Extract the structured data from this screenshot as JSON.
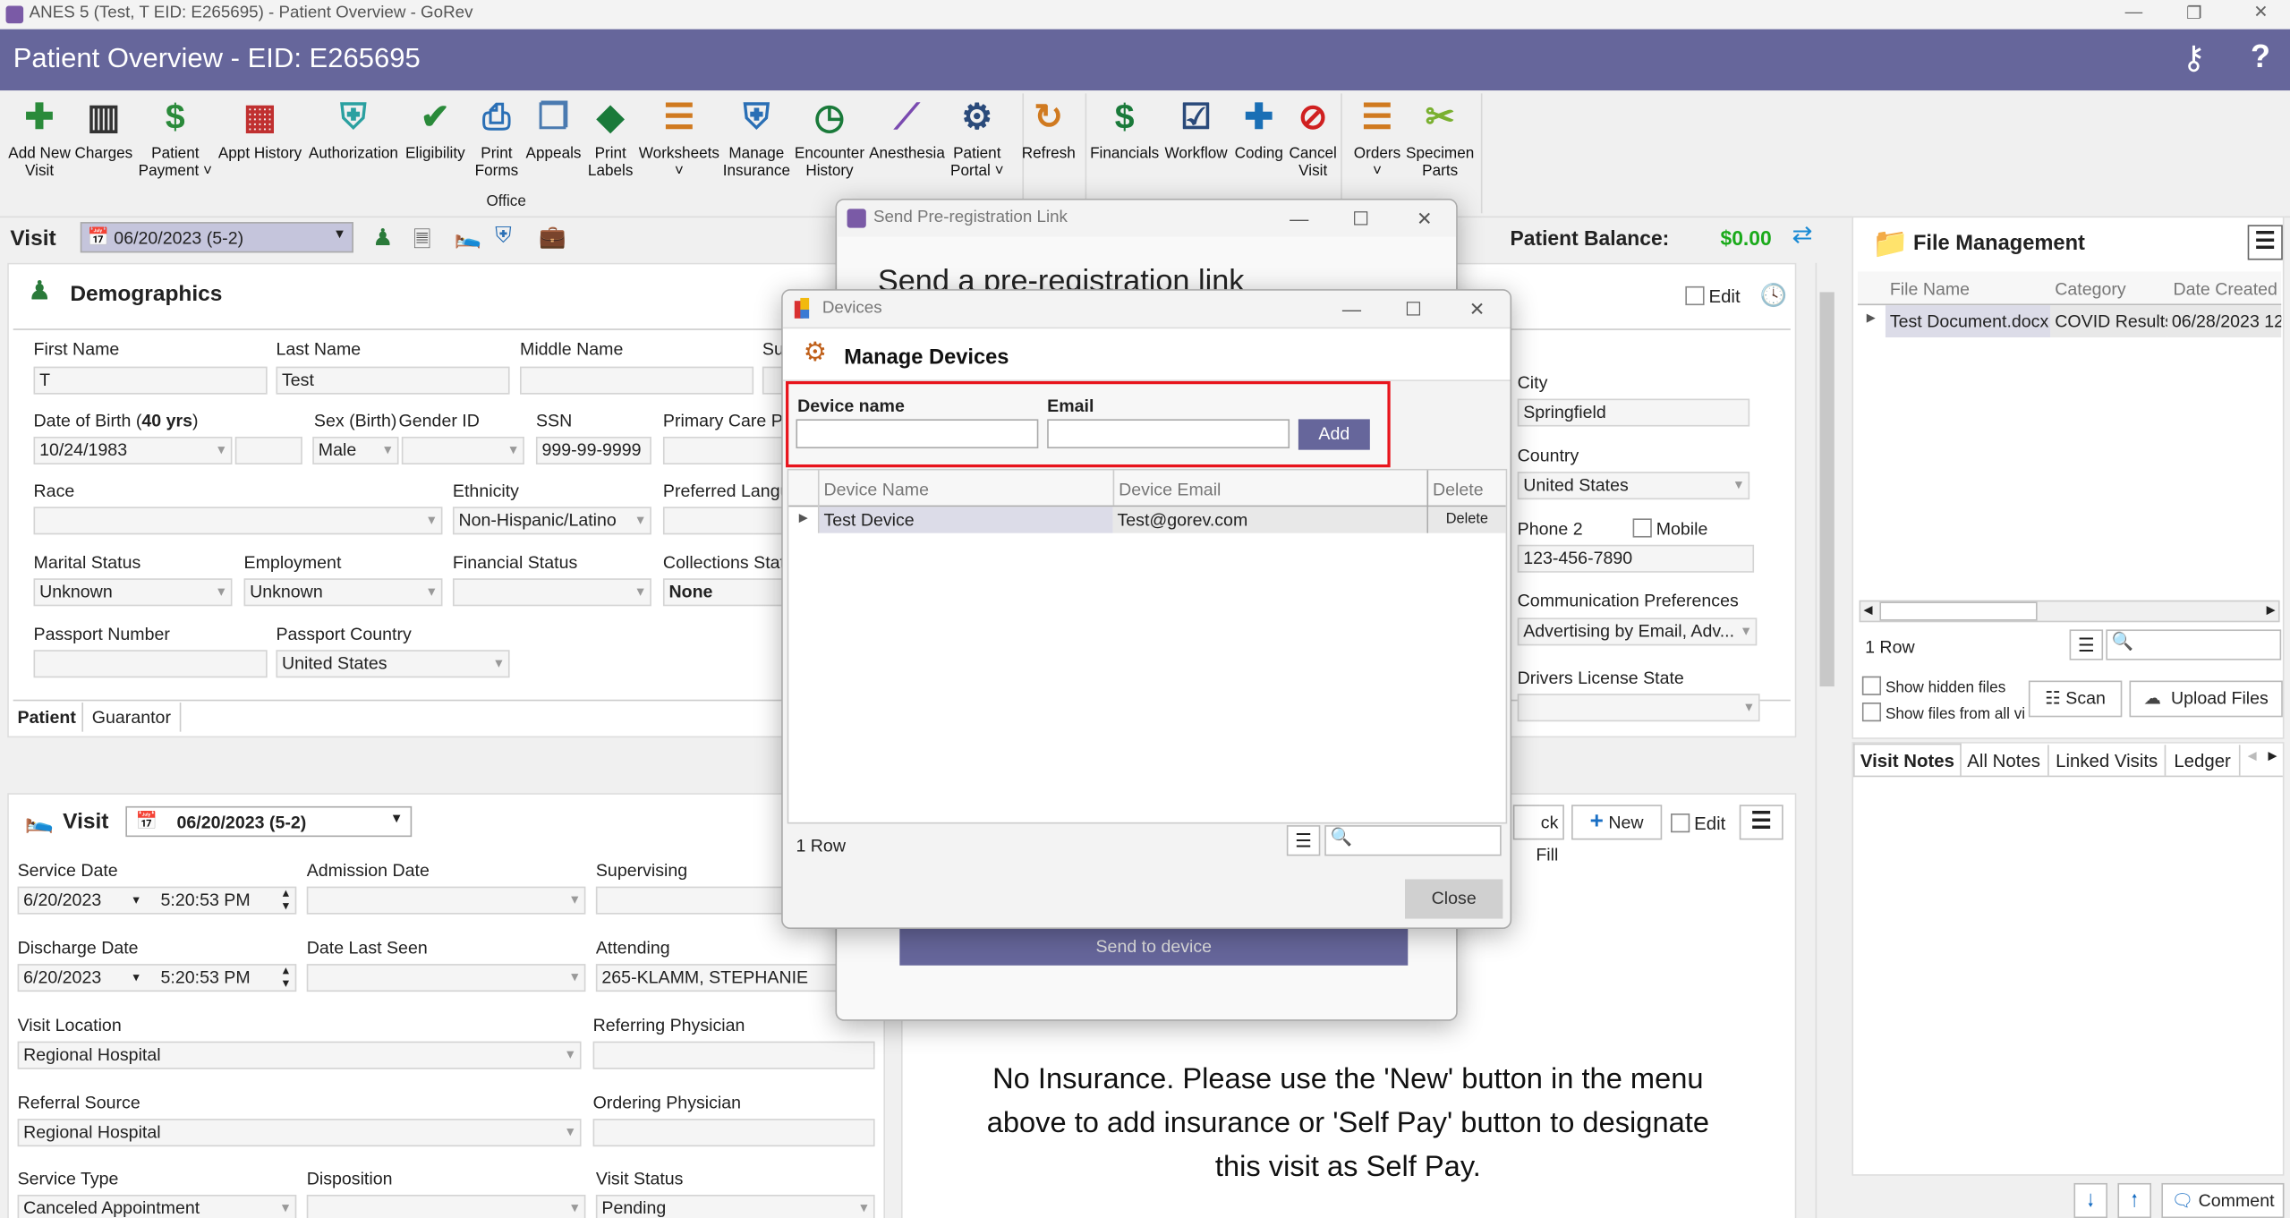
{
  "window": {
    "title": "ANES 5 (Test, T EID: E265695) - Patient Overview - GoRev"
  },
  "header": {
    "title": "Patient Overview - EID: E265695"
  },
  "ribbon": {
    "buttons": [
      {
        "label": "Add New\nVisit",
        "icon": "add-visit-icon"
      },
      {
        "label": "Charges",
        "icon": "barcode-icon"
      },
      {
        "label": "Patient\nPayment ˅",
        "icon": "payment-icon"
      },
      {
        "label": "Appt History",
        "icon": "calendar-icon"
      },
      {
        "label": "Authorization",
        "icon": "shield-clipboard-icon"
      },
      {
        "label": "Eligibility",
        "icon": "user-check-icon"
      },
      {
        "label": "Print\nForms",
        "icon": "printer-icon"
      },
      {
        "label": "Appeals",
        "icon": "documents-icon"
      },
      {
        "label": "Print\nLabels",
        "icon": "tag-icon"
      },
      {
        "label": "Worksheets\n˅",
        "icon": "worksheet-icon"
      },
      {
        "label": "Manage\nInsurance",
        "icon": "insurance-icon"
      },
      {
        "label": "Encounter\nHistory",
        "icon": "calendar-clock-icon"
      },
      {
        "label": "Anesthesia",
        "icon": "syringe-icon"
      },
      {
        "label": "Patient\nPortal ˅",
        "icon": "globe-gear-icon"
      },
      {
        "label": "Refresh",
        "icon": "refresh-icon"
      },
      {
        "label": "Financials",
        "icon": "dollar-icon"
      },
      {
        "label": "Workflow",
        "icon": "checklist-icon"
      },
      {
        "label": "Coding",
        "icon": "book-icon"
      },
      {
        "label": "Cancel\nVisit",
        "icon": "cancel-clock-icon"
      },
      {
        "label": "Orders\n˅",
        "icon": "orders-icon"
      },
      {
        "label": "Specimen\nParts",
        "icon": "specimen-icon"
      }
    ],
    "group_office": "Office"
  },
  "visitbar": {
    "label": "Visit",
    "selected": "06/20/2023 (5-2)",
    "balance_label": "Patient Balance:",
    "balance": "$0.00"
  },
  "demographics": {
    "title": "Demographics",
    "edit": "Edit",
    "dob_label": "Date of Birth (",
    "dob_age": "40 yrs",
    "dob_close": ")",
    "fields": {
      "first_name": {
        "label": "First Name",
        "value": "T"
      },
      "last_name": {
        "label": "Last Name",
        "value": "Test"
      },
      "middle_name": {
        "label": "Middle Name",
        "value": ""
      },
      "suffix": {
        "label": "Su",
        "value": ""
      },
      "dob": {
        "label": "",
        "value": "10/24/1983"
      },
      "sex": {
        "label": "Sex (Birth)",
        "value": "Male"
      },
      "gender": {
        "label": "Gender ID",
        "value": ""
      },
      "ssn": {
        "label": "SSN",
        "value": "999-99-9999"
      },
      "pcp": {
        "label": "Primary Care Ph",
        "value": ""
      },
      "race": {
        "label": "Race",
        "value": ""
      },
      "ethnicity": {
        "label": "Ethnicity",
        "value": "Non-Hispanic/Latino"
      },
      "language": {
        "label": "Preferred Langu",
        "value": ""
      },
      "marital": {
        "label": "Marital Status",
        "value": "Unknown"
      },
      "employment": {
        "label": "Employment",
        "value": "Unknown"
      },
      "financial": {
        "label": "Financial Status",
        "value": ""
      },
      "collections": {
        "label": "Collections Stat",
        "value": "None"
      },
      "passport_number": {
        "label": "Passport Number",
        "value": ""
      },
      "passport_country": {
        "label": "Passport Country",
        "value": "United States"
      },
      "city": {
        "label": "City",
        "value": "Springfield"
      },
      "country": {
        "label": "Country",
        "value": "United States"
      },
      "phone2": {
        "label": "Phone 2",
        "value": "123-456-7890"
      },
      "comm": {
        "label": "Communication Preferences",
        "value": "Advertising by Email, Adv..."
      },
      "dl_state": {
        "label": "Drivers License State",
        "value": ""
      }
    },
    "mobile_label": "Mobile",
    "tabs": [
      "Patient",
      "Guarantor"
    ]
  },
  "visit": {
    "title": "Visit",
    "selected": "06/20/2023 (5-2)",
    "fields": {
      "service_date": {
        "label": "Service Date",
        "value": "6/20/2023",
        "time": "5:20:53 PM"
      },
      "admission_date": {
        "label": "Admission Date",
        "value": ""
      },
      "supervising": {
        "label": "Supervising",
        "value": ""
      },
      "discharge_date": {
        "label": "Discharge Date",
        "value": "6/20/2023",
        "time": "5:20:53 PM"
      },
      "date_last_seen": {
        "label": "Date Last Seen",
        "value": ""
      },
      "attending": {
        "label": "Attending",
        "value": "265-KLAMM, STEPHANIE"
      },
      "visit_location": {
        "label": "Visit Location",
        "value": "Regional Hospital"
      },
      "referring": {
        "label": "Referring Physician",
        "value": ""
      },
      "referral_source": {
        "label": "Referral Source",
        "value": "Regional Hospital"
      },
      "ordering": {
        "label": "Ordering Physician",
        "value": ""
      },
      "service_type": {
        "label": "Service Type",
        "value": "Canceled Appointment"
      },
      "disposition": {
        "label": "Disposition",
        "value": ""
      },
      "visit_status": {
        "label": "Visit Status",
        "value": "Pending"
      }
    }
  },
  "insurance": {
    "quick_fill": "ck Fill",
    "new": "New",
    "edit": "Edit",
    "message": "No Insurance.  Please use the 'New' button in the menu above to add insurance or 'Self Pay' button to designate this visit as Self Pay."
  },
  "files": {
    "title": "File Management",
    "columns": [
      "File Name",
      "Category",
      "Date Created"
    ],
    "rows": [
      [
        "Test Document.docx",
        "COVID Results",
        "06/28/2023 12"
      ]
    ],
    "row_count": "1 Row",
    "show_hidden": "Show hidden files",
    "show_all": "Show files from all visits",
    "scan": "Scan",
    "upload": "Upload Files"
  },
  "notes": {
    "tabs": [
      "Visit Notes",
      "All Notes",
      "Linked Visits",
      "Ledger"
    ],
    "comment": "Comment"
  },
  "prereg": {
    "title": "Send Pre-registration Link",
    "heading": "Send a pre-registration link",
    "send": "Send to device"
  },
  "devices": {
    "title": "Devices",
    "heading": "Manage Devices",
    "device_name_label": "Device name",
    "email_label": "Email",
    "device_name_value": "",
    "email_value": "",
    "add": "Add",
    "columns": [
      "Device Name",
      "Device Email",
      "Delete"
    ],
    "rows": [
      {
        "name": "Test Device",
        "email": "Test@gorev.com",
        "delete": "Delete"
      }
    ],
    "row_count": "1 Row",
    "close": "Close"
  },
  "colors": {
    "header": "#66669b",
    "balance": "#1aaa1a",
    "highlight": "#e8141c",
    "accent": "#66669b"
  }
}
